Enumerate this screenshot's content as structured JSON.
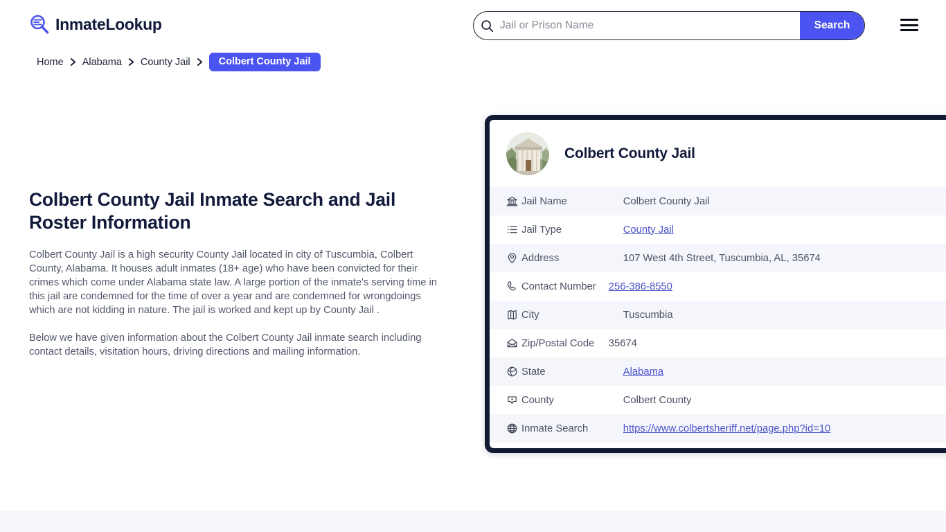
{
  "brand": {
    "name": "InmateLookup",
    "logo_icon": "search-list-icon",
    "accent_color": "#4b53f0",
    "dark_color": "#111a32"
  },
  "header": {
    "search": {
      "placeholder": "Jail or Prison Name",
      "value": "",
      "icon": "search-icon",
      "button_label": "Search"
    },
    "menu_icon": "hamburger-menu-icon"
  },
  "breadcrumb": {
    "items": [
      {
        "label": "Home",
        "current": false
      },
      {
        "label": "Alabama",
        "current": false
      },
      {
        "label": "County Jail",
        "current": false
      },
      {
        "label": "Colbert County Jail",
        "current": true
      }
    ],
    "separator_icon": "chevron-right-icon"
  },
  "main": {
    "title": "Colbert County Jail Inmate Search and Jail Roster Information",
    "paragraphs": [
      "Colbert County Jail is a high security County Jail located in city of Tuscumbia, Colbert County, Alabama. It houses adult inmates (18+ age) who have been convicted for their crimes which come under Alabama state law. A large portion of the inmate's serving time in this jail are condemned for the time of over a year and are condemned for wrongdoings which are not kidding in nature. The jail is worked and kept up by County Jail .",
      "Below we have given information about the Colbert County Jail inmate search including contact details, visitation hours, driving directions and mailing information."
    ]
  },
  "card": {
    "avatar_icon": "courthouse-photo",
    "title": "Colbert County Jail",
    "rows": [
      {
        "icon": "bank-icon",
        "label": "Jail Name",
        "value": "Colbert County Jail",
        "link": false
      },
      {
        "icon": "list-icon",
        "label": "Jail Type",
        "value": "County Jail",
        "link": true
      },
      {
        "icon": "map-pin-icon",
        "label": "Address",
        "value": "107 West 4th Street, Tuscumbia, AL, 35674",
        "link": false
      },
      {
        "icon": "phone-icon",
        "label": "Contact Number",
        "value": "256-386-8550",
        "link": true
      },
      {
        "icon": "map-icon",
        "label": "City",
        "value": "Tuscumbia",
        "link": false
      },
      {
        "icon": "envelope-icon",
        "label": "Zip/Postal Code",
        "value": "35674",
        "link": false
      },
      {
        "icon": "globe-icon",
        "label": "State",
        "value": "Alabama",
        "link": true
      },
      {
        "icon": "county-map-icon",
        "label": "County",
        "value": "Colbert County",
        "link": false
      },
      {
        "icon": "web-globe-icon",
        "label": "Inmate Search",
        "value": "https://www.colbertsheriff.net/page.php?id=10",
        "link": true
      }
    ]
  }
}
